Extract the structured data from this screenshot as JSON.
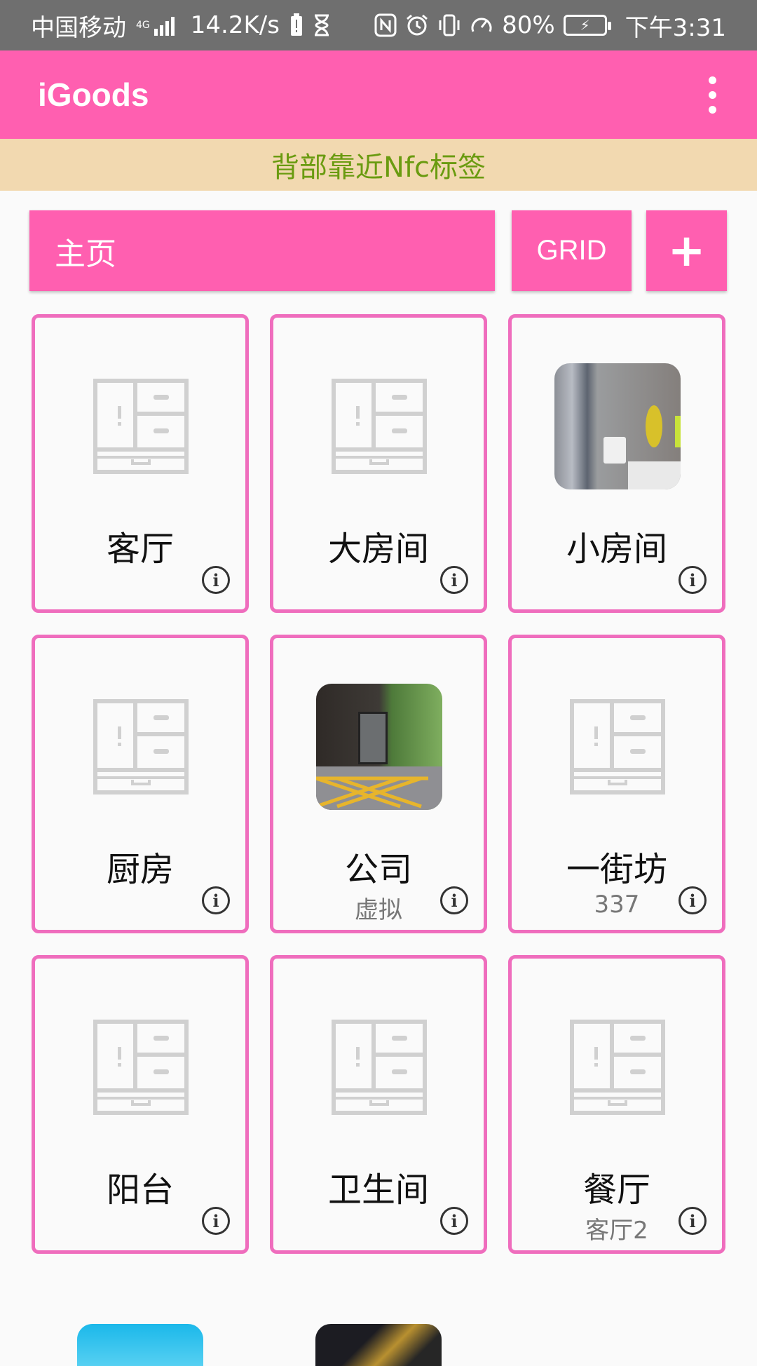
{
  "status_bar": {
    "carrier": "中国移动",
    "signal": "4G",
    "speed": "14.2K/s",
    "battery_percent": "80%",
    "time": "下午3:31"
  },
  "app_bar": {
    "title": "iGoods"
  },
  "banner": {
    "text": "背部靠近Nfc标签"
  },
  "toolbar": {
    "home_label": "主页",
    "grid_label": "GRID",
    "add_label": "+"
  },
  "cards": [
    {
      "name": "客厅",
      "sub": "",
      "image": "cabinet-icon"
    },
    {
      "name": "大房间",
      "sub": "",
      "image": "cabinet-icon"
    },
    {
      "name": "小房间",
      "sub": "",
      "image": "room-photo"
    },
    {
      "name": "厨房",
      "sub": "",
      "image": "cabinet-icon"
    },
    {
      "name": "公司",
      "sub": "虚拟",
      "image": "entrance-photo"
    },
    {
      "name": "一街坊",
      "sub": "337",
      "image": "cabinet-icon"
    },
    {
      "name": "阳台",
      "sub": "",
      "image": "cabinet-icon"
    },
    {
      "name": "卫生间",
      "sub": "",
      "image": "cabinet-icon"
    },
    {
      "name": "餐厅",
      "sub": "客厅2",
      "image": "cabinet-icon"
    }
  ],
  "colors": {
    "accent": "#ff5fb0",
    "card_border": "#ef6dbd",
    "banner_bg": "#f2d9b0",
    "banner_text": "#6a9b10"
  }
}
